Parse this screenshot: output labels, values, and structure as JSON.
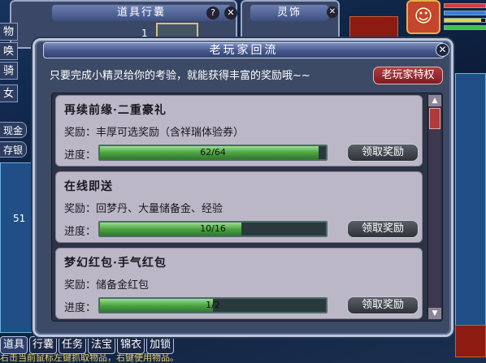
{
  "bag": {
    "title": "道具行囊",
    "help": "?",
    "close": "✕",
    "count": "1"
  },
  "spirit": {
    "title": "灵饰",
    "close": "✕"
  },
  "avatar": {
    "glyph": "☺"
  },
  "stat_bars": [
    {
      "color": "#d8383a",
      "level": 1.0
    },
    {
      "color": "#3a7ae0",
      "level": 1.0
    },
    {
      "color": "#f0d040",
      "level": 0.9
    },
    {
      "color": "#45c04a",
      "level": 1.0
    }
  ],
  "side": {
    "tabs": [
      "物",
      "唤",
      "骑",
      "女"
    ],
    "pills": [
      "现金",
      "存银"
    ],
    "bag_count": "51"
  },
  "dialog": {
    "title": "老玩家回流",
    "close": "✕",
    "intro": "只要完成小精灵给你的考验，就能获得丰富的奖励哦~~",
    "veteran_button": "老玩家特权",
    "progress_label": "进度：",
    "claim_label": "领取奖励",
    "tasks": [
      {
        "title": "再续前缘·二重豪礼",
        "reward": "奖励：丰厚可选奖励（含祥瑞体验券）",
        "current": 62,
        "total": 64,
        "progress_text": "62/64"
      },
      {
        "title": "在线即送",
        "reward": "奖励：回梦丹、大量储备金、经验",
        "current": 10,
        "total": 16,
        "progress_text": "10/16"
      },
      {
        "title": "梦幻红包·手气红包",
        "reward": "奖励：储备金红包",
        "current": 1,
        "total": 2,
        "progress_text": "1/2"
      }
    ],
    "scroll": {
      "up": "▲",
      "down": "▼"
    }
  },
  "bottom_tabs": [
    "道具",
    "行囊",
    "任务",
    "法宝",
    "锦衣",
    "加锁"
  ],
  "status": "右击当前鼠标左键抓取物品，右键使用物品。",
  "colors": {
    "accent_red": "#b23a3f",
    "progress_green": "#4ea445",
    "card_bg": "#bcb7c7"
  }
}
